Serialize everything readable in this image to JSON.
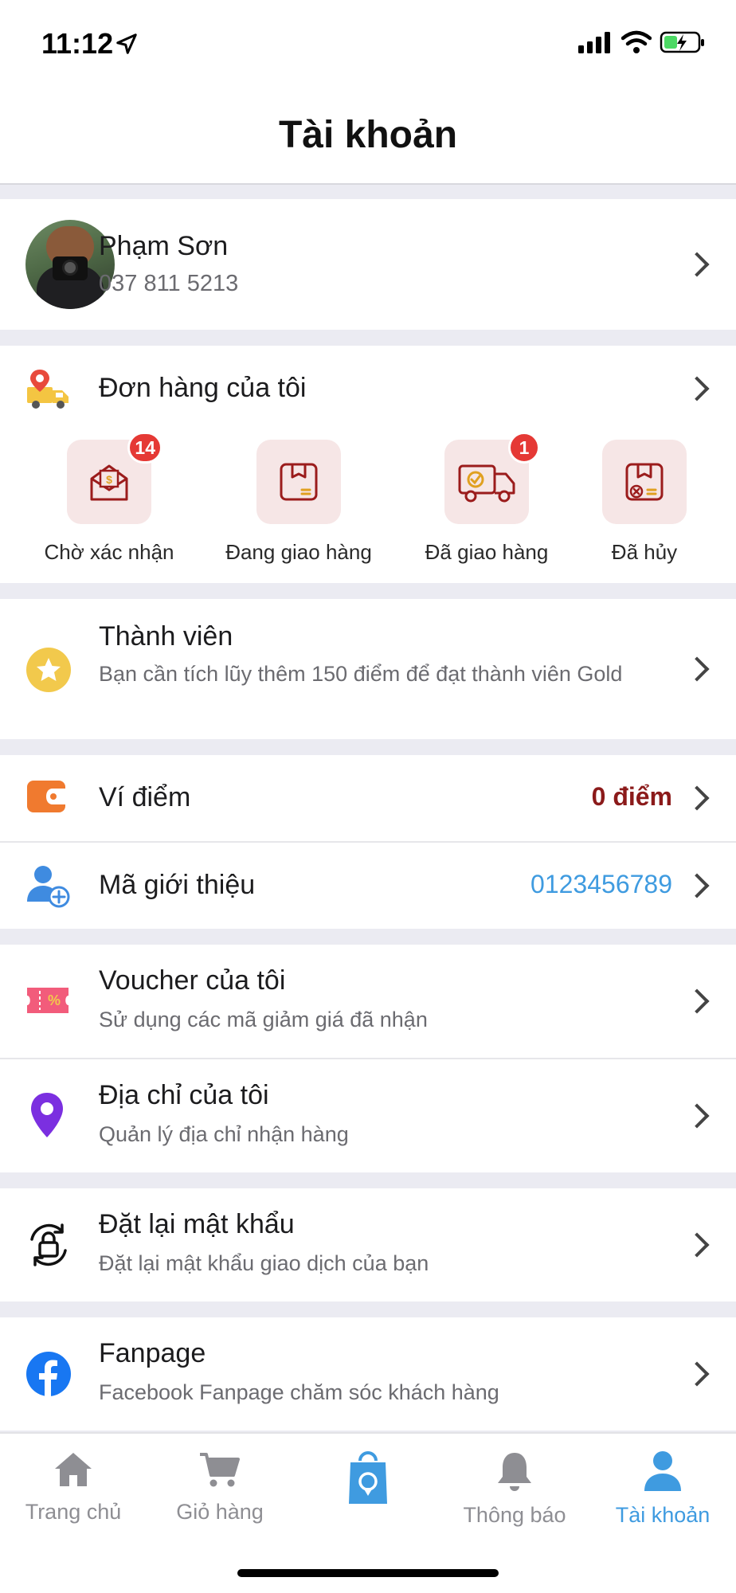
{
  "status_bar": {
    "time": "11:12"
  },
  "header": {
    "title": "Tài khoản"
  },
  "profile": {
    "name": "Phạm Sơn",
    "phone": "037 811 5213"
  },
  "orders": {
    "title": "Đơn hàng của tôi",
    "statuses": [
      {
        "label": "Chờ xác nhận",
        "badge": "14"
      },
      {
        "label": "Đang giao hàng",
        "badge": ""
      },
      {
        "label": "Đã giao hàng",
        "badge": "1"
      },
      {
        "label": "Đã hủy",
        "badge": ""
      }
    ]
  },
  "membership": {
    "title": "Thành viên",
    "subtitle": "Bạn cần tích lũy thêm 150 điểm để đạt thành viên Gold"
  },
  "wallet": {
    "title": "Ví điểm",
    "value": "0 điểm"
  },
  "referral": {
    "title": "Mã giới thiệu",
    "value": "0123456789"
  },
  "voucher": {
    "title": "Voucher của tôi",
    "subtitle": "Sử dụng các mã giảm giá đã nhận"
  },
  "address": {
    "title": "Địa chỉ của tôi",
    "subtitle": "Quản lý địa chỉ nhận hàng"
  },
  "password": {
    "title": "Đặt lại mật khẩu",
    "subtitle": "Đặt lại mật khẩu giao dịch của bạn"
  },
  "fanpage": {
    "title": "Fanpage",
    "subtitle": "Facebook Fanpage chăm sóc khách hàng"
  },
  "tabs": [
    {
      "label": "Trang chủ",
      "icon": "home-icon"
    },
    {
      "label": "Giỏ hàng",
      "icon": "cart-icon"
    },
    {
      "label": "",
      "icon": "shopping-bag-icon"
    },
    {
      "label": "Thông báo",
      "icon": "bell-icon"
    },
    {
      "label": "Tài khoản",
      "icon": "user-icon"
    }
  ],
  "colors": {
    "accent": "#3f9be0",
    "points": "#8b1a1a",
    "referral": "#3f9be0",
    "badge": "#e53935"
  }
}
